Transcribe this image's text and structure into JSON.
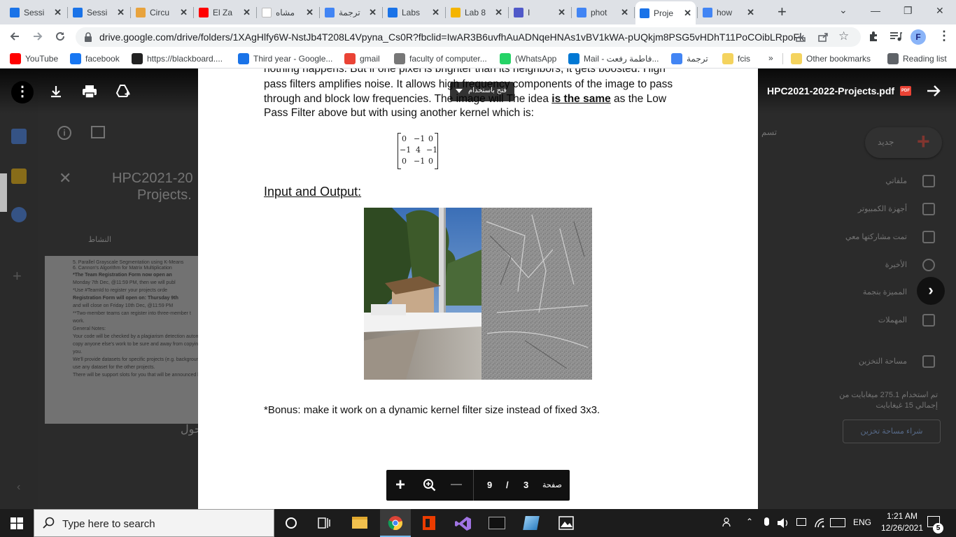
{
  "tabs": [
    {
      "label": "Sessi",
      "color": "#1a73e8"
    },
    {
      "label": "Sessi",
      "color": "#1a73e8"
    },
    {
      "label": "Circu",
      "color": "#e8a33d"
    },
    {
      "label": "El Za",
      "color": "#ff0000"
    },
    {
      "label": "مشاه",
      "color": "#ffffff"
    },
    {
      "label": "ترجمة",
      "color": "#4285f4"
    },
    {
      "label": "Labs",
      "color": "#1a73e8"
    },
    {
      "label": "Lab 8",
      "color": "#f4b400"
    },
    {
      "label": "I",
      "color": "#5059c9"
    },
    {
      "label": "phot",
      "color": "#4285f4"
    },
    {
      "label": "Proje",
      "color": "#1a73e8"
    },
    {
      "label": "how",
      "color": "#4285f4"
    }
  ],
  "toolbar": {
    "url": "drive.google.com/drive/folders/1XAgHlfy6W-NstJb4T208L4Vpyna_Cs0R?fbclid=IwAR3B6uvfhAuADNqeHNAs1vBV1kWA-pUQkjm8PSG5vHDhT11PoCOibLRpoFk",
    "profile_initial": "F"
  },
  "bookmarks": [
    {
      "label": "YouTube",
      "color": "#ff0000"
    },
    {
      "label": "facebook",
      "color": "#1877f2"
    },
    {
      "label": "https://blackboard....",
      "color": "#222222"
    },
    {
      "label": "Third year - Google...",
      "color": "#1a73e8"
    },
    {
      "label": "gmail",
      "color": "#ea4335"
    },
    {
      "label": "faculty of computer...",
      "color": "#777777"
    },
    {
      "label": "(WhatsApp",
      "color": "#25d366"
    },
    {
      "label": "Mail - فاطمة رفعت...",
      "color": "#0078d4"
    },
    {
      "label": "ترجمة",
      "color": "#4285f4"
    },
    {
      "label": "fcis",
      "color": "#f4d35e"
    }
  ],
  "bookmarks_right": {
    "more": "»",
    "other": "Other bookmarks",
    "reading": "Reading list"
  },
  "viewer": {
    "file_name": "HPC2021-2022-Projects.pdf",
    "file_badge": "PDF",
    "open_with": "فتح باستخدام"
  },
  "drive_bg": {
    "title_line1": "HPC2021-20",
    "title_line2": "Projects.",
    "activity_tab": "النشاط",
    "new_button": "جديد",
    "nav_items": [
      "ملفاتي",
      "أجهزة الكمبيوتر",
      "تمت مشاركتها معي",
      "الأخيرة",
      "المميزة بنجمة",
      "المهملات",
      "مساحة التخزين"
    ],
    "storage_text": "تم استخدام 275.1 ميغابايت من إجمالي 15 غيغابايت",
    "buy_storage": "شراء مساحة تخزين",
    "side_word": "حول",
    "top_right_word": "تسم",
    "preview_lines": [
      "5. Parallel Grayscale Segmentation using K-Means",
      "6. Cannon's Algorithm for Matrix Multiplication",
      "*The Team Registration Form now open an",
      "Monday 7th Dec, @11:59 PM, then we will publ",
      "*Use #TeamId to register your projects orde",
      "Registration Form will open on: Thursday 9th",
      "and will close on Friday 10th Dec, @11:59 PM",
      "**Two-member teams can register into three-member t",
      "work.",
      "General Notes:",
      "Your code will be checked by a plagiarism detection automat",
      "copy anyone else's work to be sure and away from copying",
      "you.",
      "We'll provide datasets for specific projects (e.g. background",
      "use any dataset for the other projects.",
      "There will be support slots for you that will be announced lat"
    ]
  },
  "pdf": {
    "line0": "nothing happens. But if one pixel is brighter than its neighbors, it gets boosted. High",
    "line1": "pass filters amplifies noise. It allows high frequency components of the image to pass",
    "line2": "through and block low frequencies. The image will The idea",
    "line2_bold": "is the same",
    "line2_end": "as the Low",
    "line3": "Pass Filter above but with using another kernel which is:",
    "kernel": [
      [
        "0",
        "−1",
        "0"
      ],
      [
        "−1",
        "4",
        "−1"
      ],
      [
        "0",
        "−1",
        "0"
      ]
    ],
    "section_title": "Input and Output:",
    "bonus": "*Bonus: make it work on a dynamic kernel filter size instead of fixed 3x3."
  },
  "page_nav": {
    "current": "3",
    "sep": "/",
    "total": "9",
    "label": "صفحة",
    "zoom_in": "+",
    "zoom_out": "—"
  },
  "taskbar": {
    "search_placeholder": "Type here to search",
    "lang": "ENG",
    "time": "1:21 AM",
    "date": "12/26/2021",
    "notif_count": "5"
  }
}
